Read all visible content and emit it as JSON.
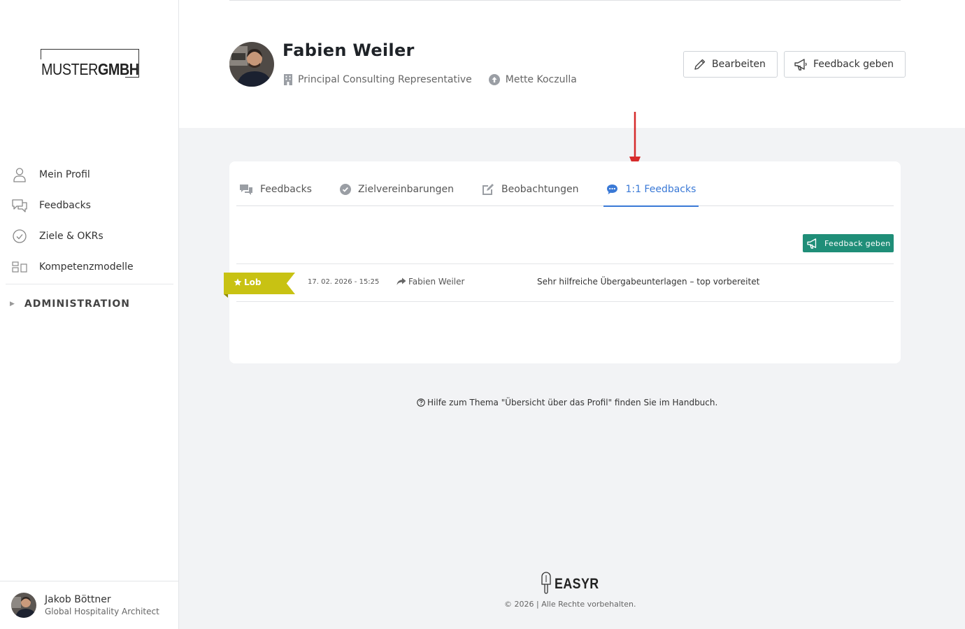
{
  "sidebar": {
    "logo": {
      "part1": "MUSTER",
      "part2": "GMBH"
    },
    "items": [
      {
        "label": "Mein Profil",
        "icon": "user-icon"
      },
      {
        "label": "Feedbacks",
        "icon": "chat-bubbles-icon"
      },
      {
        "label": "Ziele & OKRs",
        "icon": "check-circle-icon"
      },
      {
        "label": "Kompetenzmodelle",
        "icon": "grid-icon"
      }
    ],
    "admin_label": "ADMINISTRATION",
    "user": {
      "name": "Jakob Böttner",
      "role": "Global Hospitality Architect"
    }
  },
  "profile": {
    "name": "Fabien Weiler",
    "position": "Principal Consulting Representative",
    "manager": "Mette Koczulla",
    "edit_label": "Bearbeiten",
    "feedback_label": "Feedback geben"
  },
  "tabs": [
    {
      "label": "Feedbacks",
      "icon": "chat-bubbles-icon",
      "active": false
    },
    {
      "label": "Zielvereinbarungen",
      "icon": "check-circle-icon",
      "active": false
    },
    {
      "label": "Beobachtungen",
      "icon": "edit-icon",
      "active": false
    },
    {
      "label": "1:1 Feedbacks",
      "icon": "comment-dots-icon",
      "active": true
    }
  ],
  "list": {
    "action_label": "Feedback geben",
    "rows": [
      {
        "type": "Lob",
        "date": "17. 02. 2026 - 15:25",
        "from": "Fabien Weiler",
        "message": "Sehr hilfreiche Übergabeunterlagen – top vorbereitet"
      }
    ]
  },
  "help": {
    "text": "Hilfe zum Thema \"Übersicht über das Profil\" finden Sie im Handbuch."
  },
  "footer": {
    "brand": "EASYR",
    "copyright": "© 2026 | Alle Rechte vorbehalten."
  },
  "colors": {
    "accent_blue": "#3a79d6",
    "green_button": "#1f8e78",
    "lob_ribbon": "#c8c213",
    "arrow_red": "#d62b2b"
  }
}
